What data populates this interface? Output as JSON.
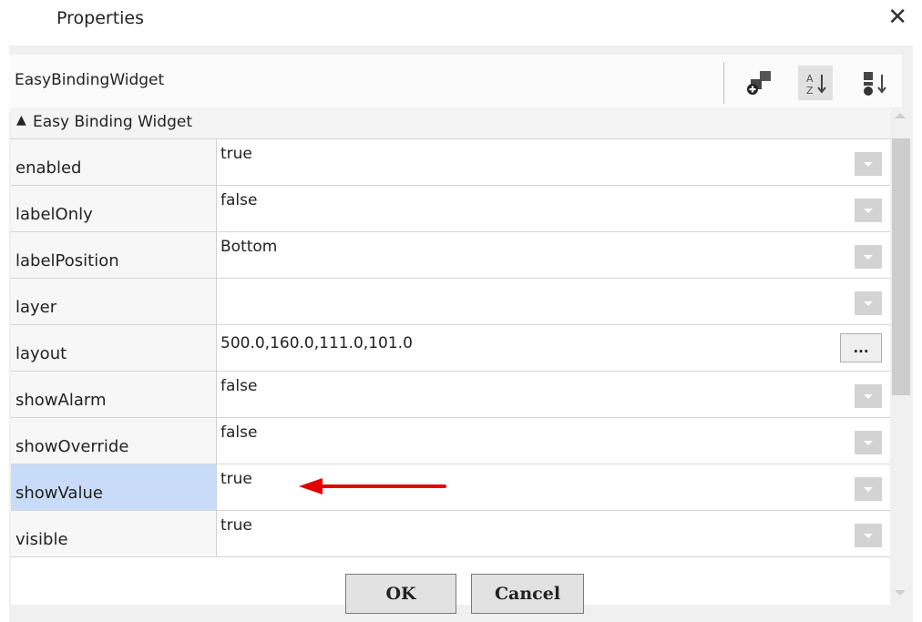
{
  "window": {
    "title": "Properties",
    "close_glyph": "✕"
  },
  "header": {
    "title": "EasyBindingWidget"
  },
  "toolbar": {
    "buttons": [
      {
        "icon": "add-component-icon"
      },
      {
        "icon": "sort-alphabetical-icon",
        "glyph_top": "A",
        "glyph_bottom": "Z"
      },
      {
        "icon": "sort-category-icon"
      }
    ]
  },
  "group": {
    "label": "Easy Binding Widget",
    "collapse_glyph": "▲"
  },
  "rows": [
    {
      "name": "enabled",
      "value": "true"
    },
    {
      "name": "labelOnly",
      "value": "false"
    },
    {
      "name": "labelPosition",
      "value": "Bottom"
    },
    {
      "name": "layer",
      "value": ""
    },
    {
      "name": "layout",
      "value": "500.0,160.0,111.0,101.0",
      "button": "..."
    },
    {
      "name": "showAlarm",
      "value": "false"
    },
    {
      "name": "showOverride",
      "value": "false"
    },
    {
      "name": "showValue",
      "value": "true"
    },
    {
      "name": "visible",
      "value": "true"
    }
  ],
  "buttons": {
    "ok": "OK",
    "cancel": "Cancel"
  },
  "colors": {
    "selected_row": "#c8dbf8",
    "arrow": "#e30000"
  }
}
